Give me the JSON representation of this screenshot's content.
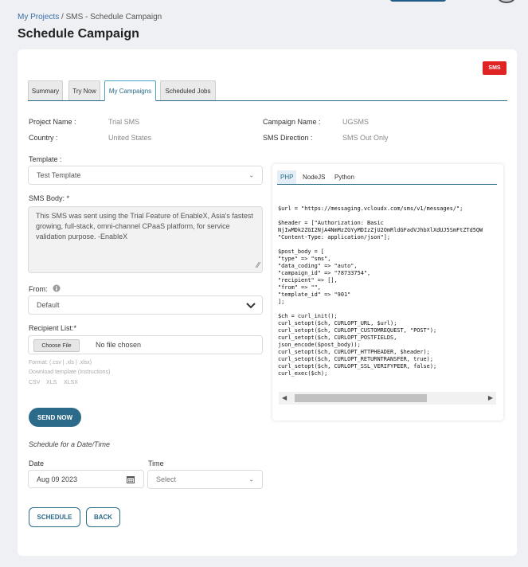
{
  "breadcrumb": {
    "root": "My Projects",
    "separator": "/",
    "current": "SMS - Schedule Campaign"
  },
  "page": {
    "title": "Schedule Campaign",
    "badge": "SMS"
  },
  "tabs": [
    "Summary",
    "Try Now",
    "My Campaigns",
    "Scheduled Jobs"
  ],
  "active_tab": "My Campaigns",
  "info": {
    "project_name_label": "Project Name :",
    "project_name": "Trial SMS",
    "country_label": "Country :",
    "country": "United States",
    "campaign_name_label": "Campaign Name :",
    "campaign_name": "UGSMS",
    "direction_label": "SMS Direction :",
    "direction": "SMS Out Only"
  },
  "form": {
    "template_label": "Template :",
    "template_value": "Test Template",
    "sms_body_label": "SMS Body: *",
    "sms_body": "This SMS was sent using the Trial Feature of  EnableX, Asia's fastest growing, full-stack, omni-channel CPaaS platform, for service validation purpose. -EnableX",
    "from_label": "From:",
    "from_value": "Default",
    "recipient_label": "Recipient List:*",
    "choose_file": "Choose File",
    "no_file": "No file chosen",
    "format_note": "Format: (.csv | .xls | .xlsx)",
    "download_note": "Download template (Instructions)",
    "formats": [
      "CSV",
      "XLS",
      "XLSX"
    ],
    "send_now": "SEND NOW",
    "schedule_heading": "Schedule for a Date/Time",
    "date_label": "Date",
    "date_value": "Aug 09 2023",
    "time_label": "Time",
    "time_placeholder": "Select",
    "schedule_btn": "SCHEDULE",
    "back_btn": "BACK"
  },
  "code": {
    "tabs": [
      "PHP",
      "NodeJS",
      "Python"
    ],
    "active": "PHP",
    "text": "$url = \"https://messaging.vcloudx.com/sms/v1/messages/\";\n\n$header = [\"Authorization: Basic\nNjIwMDk2ZGI2NjA4NmMzZGYyMDIzZjU2OmRldGFadVJhbXlXdUJ5SmFtZTd5QW\n\"Content-Type: application/json\"];\n\n$post_body = [\n\"type\" => \"sms\",\n\"data_coding\" => \"auto\",\n\"campaign_id\" => \"78733754\",\n\"recipient\" => [],\n\"from\" => \"\",\n\"template_id\" => \"901\"\n];\n\n$ch = curl_init();\ncurl_setopt($ch, CURLOPT_URL, $url);\ncurl_setopt($ch, CURLOPT_CUSTOMREQUEST, \"POST\");\ncurl_setopt($ch, CURLOPT_POSTFIELDS,\njson_encode($post_body));\ncurl_setopt($ch, CURLOPT_HTTPHEADER, $header);\ncurl_setopt($ch, CURLOPT_RETURNTRANSFER, true);\ncurl_setopt($ch, CURLOPT_SSL_VERIFYPEER, false);\ncurl_exec($ch);"
  },
  "colors": {
    "accent": "#2c6a8a",
    "badge": "#e02424",
    "link": "#3a6fa8"
  },
  "icons": {
    "template_chevron": "chevron-down-icon",
    "from_chevron": "chevron-down-icon",
    "info": "info-icon",
    "calendar": "calendar-icon",
    "resize": "resize-handle-icon",
    "scroll_left": "caret-left-icon",
    "scroll_right": "caret-right-icon"
  }
}
